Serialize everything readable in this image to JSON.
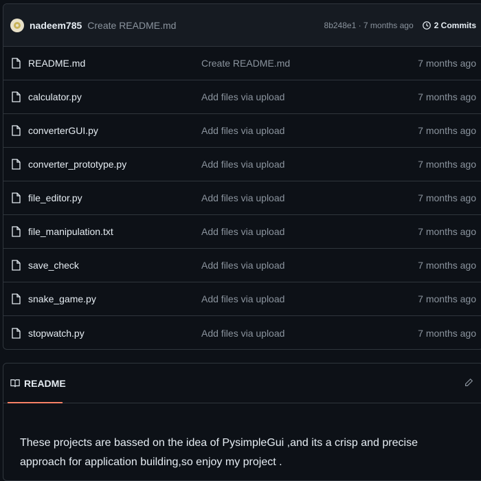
{
  "commit": {
    "author": "nadeem785",
    "message": "Create README.md",
    "meta": "8b248e1 · 7 months ago",
    "commits_label": "2 Commits"
  },
  "files": [
    {
      "name": "README.md",
      "message": "Create README.md",
      "age": "7 months ago"
    },
    {
      "name": "calculator.py",
      "message": "Add files via upload",
      "age": "7 months ago"
    },
    {
      "name": "converterGUI.py",
      "message": "Add files via upload",
      "age": "7 months ago"
    },
    {
      "name": "converter_prototype.py",
      "message": "Add files via upload",
      "age": "7 months ago"
    },
    {
      "name": "file_editor.py",
      "message": "Add files via upload",
      "age": "7 months ago"
    },
    {
      "name": "file_manipulation.txt",
      "message": "Add files via upload",
      "age": "7 months ago"
    },
    {
      "name": "save_check",
      "message": "Add files via upload",
      "age": "7 months ago"
    },
    {
      "name": "snake_game.py",
      "message": "Add files via upload",
      "age": "7 months ago"
    },
    {
      "name": "stopwatch.py",
      "message": "Add files via upload",
      "age": "7 months ago"
    }
  ],
  "readme": {
    "tab_label": "README",
    "text": "These projects are bassed on the idea of PysimpleGui ,and its a crisp and precise approach for application building,so enjoy my project ."
  },
  "icons": {
    "file": "file-icon",
    "history": "history-icon",
    "book": "book-icon",
    "edit": "pencil-icon"
  },
  "colors": {
    "background": "#0d1117",
    "header": "#161b22",
    "border": "#30363d",
    "muted": "#8b949e",
    "accent": "#f78166"
  }
}
